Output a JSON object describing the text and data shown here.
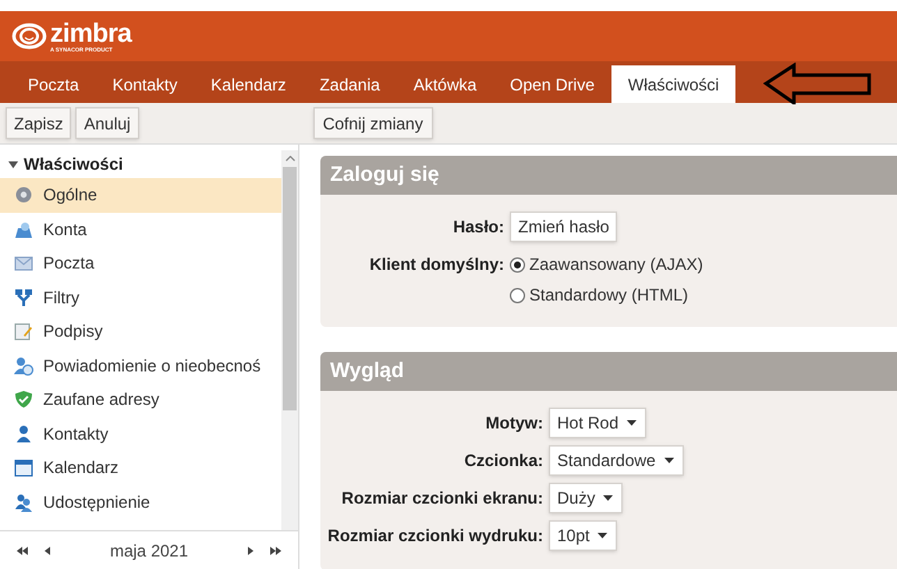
{
  "logo": {
    "name": "zimbra",
    "tagline": "A SYNACOR PRODUCT"
  },
  "tabs": [
    {
      "label": "Poczta",
      "selected": false
    },
    {
      "label": "Kontakty",
      "selected": false
    },
    {
      "label": "Kalendarz",
      "selected": false
    },
    {
      "label": "Zadania",
      "selected": false
    },
    {
      "label": "Aktówka",
      "selected": false
    },
    {
      "label": "Open Drive",
      "selected": false
    },
    {
      "label": "Właściwości",
      "selected": true
    }
  ],
  "toolbar": {
    "left_buttons": [
      "Zapisz",
      "Anuluj"
    ],
    "right_buttons": [
      "Cofnij zmiany"
    ]
  },
  "sidebar": {
    "title": "Właściwości",
    "expanded": true,
    "items": [
      {
        "label": "Ogólne",
        "selected": true
      },
      {
        "label": "Konta",
        "selected": false
      },
      {
        "label": "Poczta",
        "selected": false
      },
      {
        "label": "Filtry",
        "selected": false
      },
      {
        "label": "Podpisy",
        "selected": false
      },
      {
        "label": "Powiadomienie o nieobecnoś",
        "selected": false
      },
      {
        "label": "Zaufane adresy",
        "selected": false
      },
      {
        "label": "Kontakty",
        "selected": false
      },
      {
        "label": "Kalendarz",
        "selected": false
      },
      {
        "label": "Udostępnienie",
        "selected": false
      }
    ]
  },
  "mini_calendar": {
    "month": "maja 2021"
  },
  "sections": [
    {
      "title": "Zaloguj się",
      "rows": [
        {
          "kind": "button",
          "label": "Hasło:",
          "button": "Zmień hasło"
        },
        {
          "kind": "radio",
          "label": "Klient domyślny:",
          "options": [
            {
              "label": "Zaawansowany (AJAX)",
              "selected": true
            },
            {
              "label": "Standardowy (HTML)",
              "selected": false
            }
          ]
        }
      ]
    },
    {
      "title": "Wygląd",
      "rows": [
        {
          "kind": "select",
          "label": "Motyw:",
          "value": "Hot Rod"
        },
        {
          "kind": "select",
          "label": "Czcionka:",
          "value": "Standardowe"
        },
        {
          "kind": "select",
          "label": "Rozmiar czcionki ekranu:",
          "value": "Duży"
        },
        {
          "kind": "select",
          "label": "Rozmiar czcionki wydruku:",
          "value": "10pt"
        }
      ]
    }
  ]
}
